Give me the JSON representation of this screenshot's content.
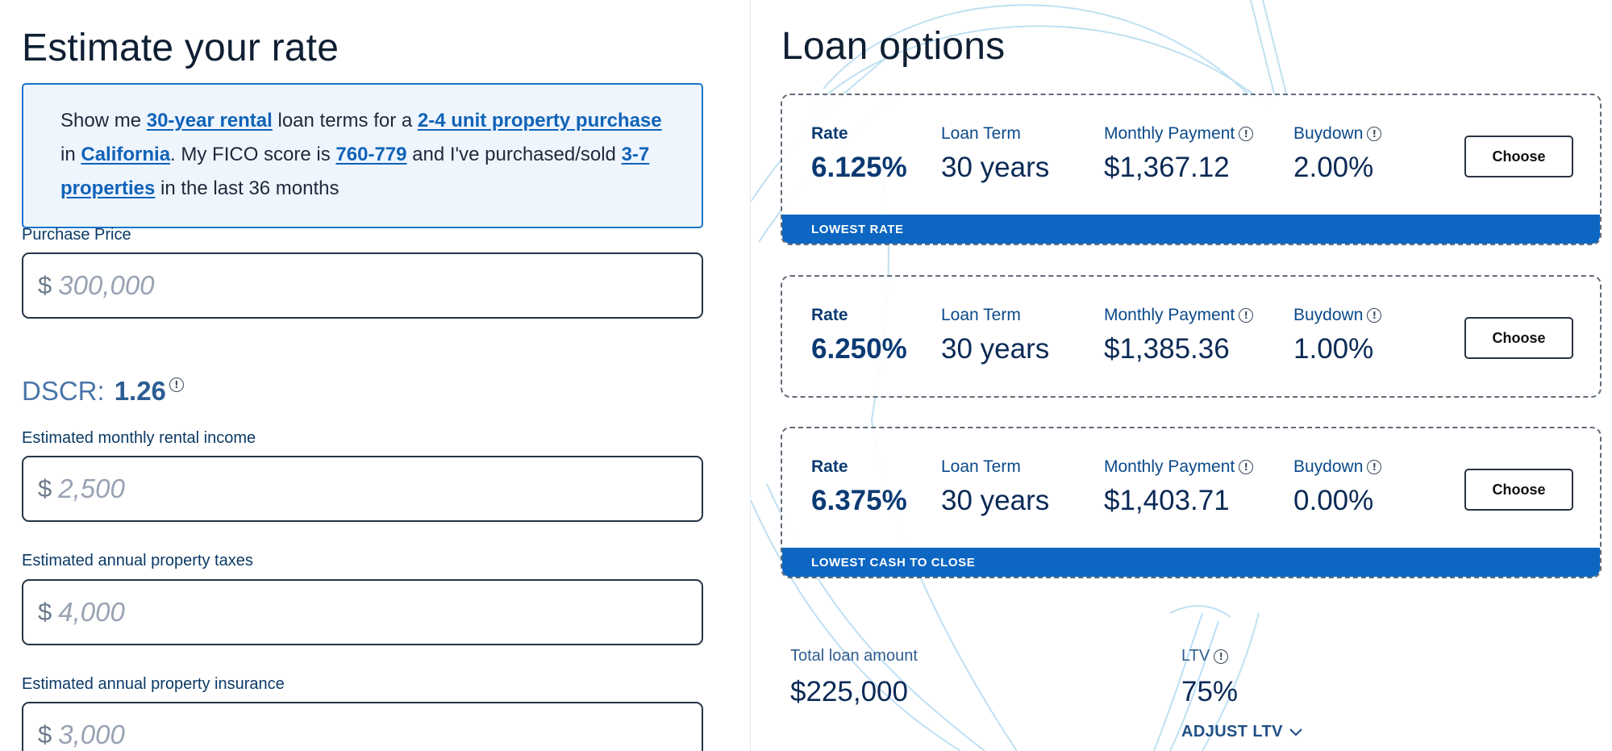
{
  "left": {
    "title": "Estimate your rate",
    "summary": {
      "t1": "Show me ",
      "loan_term_link": "30-year rental",
      "t2": " loan terms for a ",
      "property_type_link": "2-4 unit property purchase",
      "t3": " in ",
      "state_link": "California",
      "t4": ". My FICO score is ",
      "fico_link": "760-779",
      "t5": " and I've purchased/sold ",
      "experience_link": "3-7 properties",
      "t6": " in the last 36 months"
    },
    "purchase_price": {
      "label": "Purchase Price",
      "currency": "$",
      "value": "300,000"
    },
    "dscr": {
      "label": "DSCR:",
      "value": "1.26"
    },
    "rental_income": {
      "label": "Estimated monthly rental income",
      "currency": "$",
      "value": "2,500"
    },
    "property_taxes": {
      "label": "Estimated annual property taxes",
      "currency": "$",
      "value": "4,000"
    },
    "property_insurance": {
      "label": "Estimated annual property insurance",
      "currency": "$",
      "value": "3,000"
    }
  },
  "right": {
    "title": "Loan options",
    "column_labels": {
      "rate": "Rate",
      "term": "Loan Term",
      "payment": "Monthly Payment",
      "buydown": "Buydown"
    },
    "choose_label": "Choose",
    "options": [
      {
        "rate": "6.125%",
        "term": "30 years",
        "payment": "$1,367.12",
        "buydown": "2.00%",
        "band": "LOWEST RATE"
      },
      {
        "rate": "6.250%",
        "term": "30 years",
        "payment": "$1,385.36",
        "buydown": "1.00%",
        "band": ""
      },
      {
        "rate": "6.375%",
        "term": "30 years",
        "payment": "$1,403.71",
        "buydown": "0.00%",
        "band": "LOWEST CASH TO CLOSE"
      }
    ],
    "total_loan": {
      "label": "Total loan amount",
      "value": "$225,000"
    },
    "ltv": {
      "label": "LTV",
      "value": "75%"
    },
    "adjust_ltv": "ADJUST LTV"
  },
  "icons": {
    "info": "info-circle-icon",
    "chevron": "chevron-down-icon"
  },
  "colors": {
    "accent": "#0c66c2",
    "link": "#1063b8",
    "summary_bg": "#eef5fd"
  }
}
